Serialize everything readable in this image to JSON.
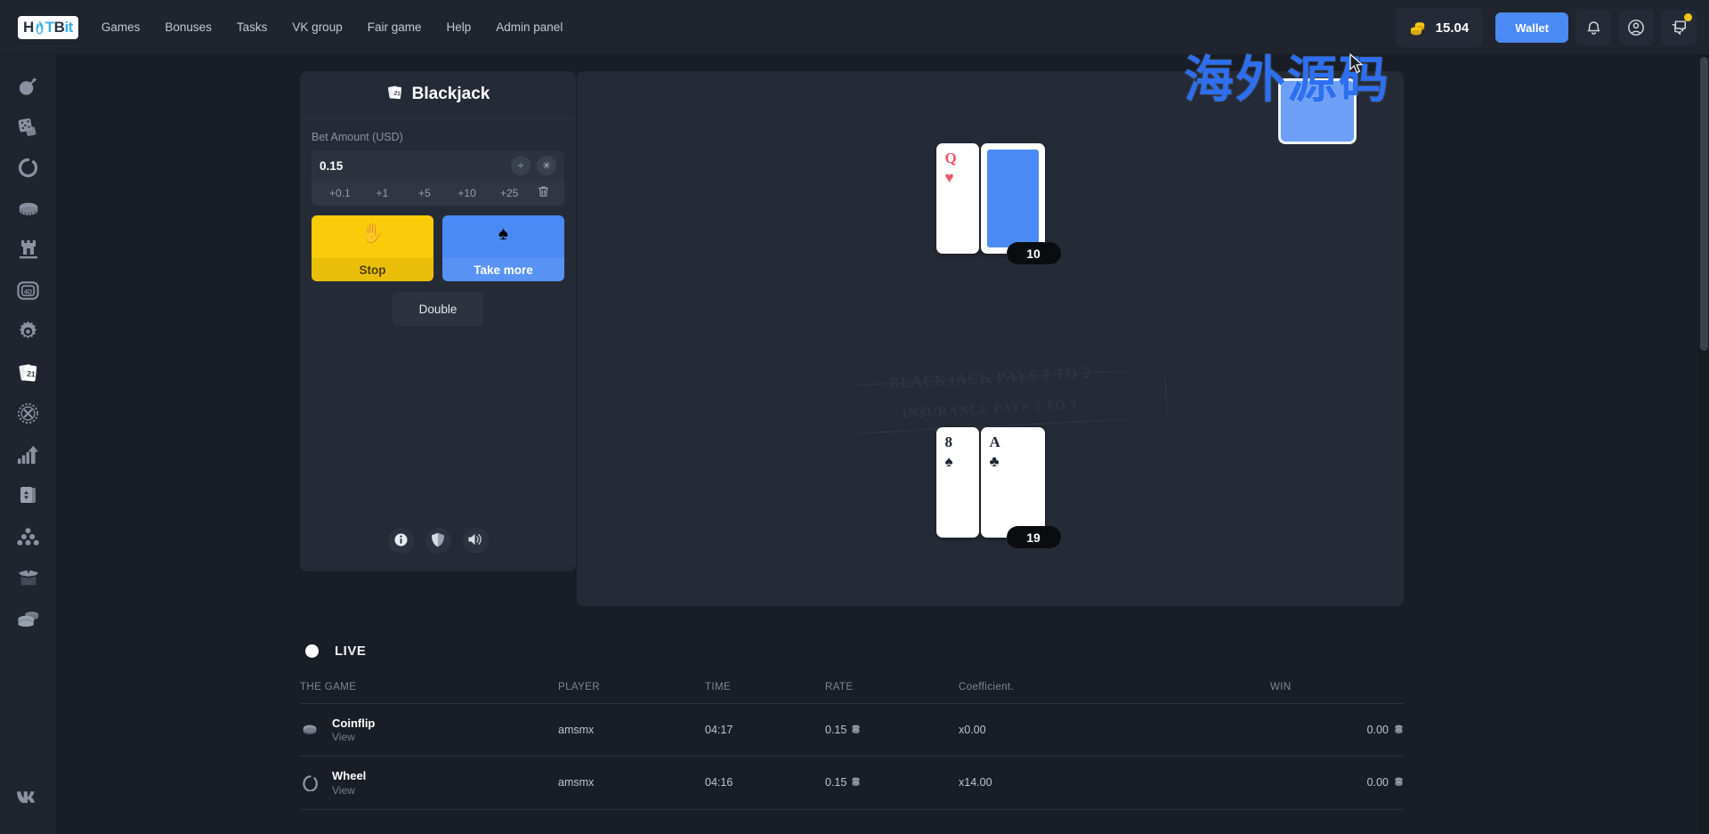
{
  "brand": {
    "logo_h": "H",
    "logo_flame": "flame-icon",
    "logo_t": "T",
    "logo_b": "B",
    "logo_it": "it"
  },
  "nav": {
    "items": [
      {
        "label": "Games"
      },
      {
        "label": "Bonuses"
      },
      {
        "label": "Tasks"
      },
      {
        "label": "VK group"
      },
      {
        "label": "Fair game"
      },
      {
        "label": "Help"
      },
      {
        "label": "Admin panel"
      }
    ]
  },
  "topbar": {
    "balance": "15.04",
    "balance_icon": "coin-stack-icon",
    "wallet_label": "Wallet",
    "bell_icon": "bell-icon",
    "profile_icon": "user-circle-icon",
    "chat_icon": "chat-bubbles-icon",
    "accent": "#4a8af4",
    "coin_color": "#f5c518"
  },
  "sidebar": {
    "items": [
      {
        "name": "mines",
        "icon": "bomb-icon"
      },
      {
        "name": "dice",
        "icon": "dice-icon"
      },
      {
        "name": "wheel",
        "icon": "ring-icon"
      },
      {
        "name": "coinflip",
        "icon": "coin-icon"
      },
      {
        "name": "tower",
        "icon": "tower-icon"
      },
      {
        "name": "slot-4d",
        "icon": "slot-4d-icon",
        "badge": "4D"
      },
      {
        "name": "settings-game",
        "icon": "gear-icon"
      },
      {
        "name": "blackjack",
        "icon": "cards-21-icon",
        "badge": "21",
        "active": true
      },
      {
        "name": "roulette",
        "icon": "roulette-x-icon"
      },
      {
        "name": "crash",
        "icon": "growth-chart-icon"
      },
      {
        "name": "hi-lo",
        "icon": "cards-hilo-icon"
      },
      {
        "name": "plinko",
        "icon": "plinko-pyramid-icon"
      },
      {
        "name": "cases",
        "icon": "open-box-icon"
      },
      {
        "name": "jackpot",
        "icon": "coin-stack-icon"
      }
    ],
    "bottom": {
      "name": "vk",
      "icon": "vk-icon"
    }
  },
  "panel": {
    "title": "Blackjack",
    "title_icon": "cards-21-icon",
    "bet_label": "Bet Amount (USD)",
    "bet_value": "0.15",
    "divide_glyph": "÷",
    "multiply_glyph": "✳",
    "divide_name": "halve-bet-button",
    "multiply_name": "double-bet-button",
    "chips": [
      {
        "label": "+0.1"
      },
      {
        "label": "+1"
      },
      {
        "label": "+5"
      },
      {
        "label": "+10"
      },
      {
        "label": "+25"
      }
    ],
    "trash_icon": "trash-icon",
    "stop_label": "Stop",
    "stop_glyph": "✋",
    "stop_color": "#f9cb0a",
    "take_label": "Take more",
    "take_glyph": "♠",
    "take_color": "#4a8af4",
    "double_label": "Double",
    "footer": [
      {
        "icon": "info-icon"
      },
      {
        "icon": "shield-icon"
      },
      {
        "icon": "sound-on-icon"
      }
    ]
  },
  "board": {
    "felt_line_1": "BLACKJACK PAYS 3 TO 2",
    "felt_line_2": "INSURANCE PAYS 2 TO 1",
    "dealer": {
      "score": "10",
      "cards": [
        {
          "rank": "Q",
          "suit": "♥",
          "color": "red",
          "face_up": true
        },
        {
          "rank": "",
          "suit": "",
          "color": "",
          "face_up": false
        }
      ]
    },
    "player": {
      "score": "19",
      "cards": [
        {
          "rank": "8",
          "suit": "♠",
          "color": "black",
          "face_up": true
        },
        {
          "rank": "A",
          "suit": "♣",
          "color": "black",
          "face_up": true
        }
      ]
    }
  },
  "watermark": {
    "text": "海外源码"
  },
  "live": {
    "label": "LIVE",
    "headers": {
      "game": "THE GAME",
      "player": "PLAYER",
      "time": "TIME",
      "rate": "RATE",
      "coefficient": "Coefficient.",
      "win": "WIN"
    },
    "rows": [
      {
        "game": "Coinflip",
        "game_icon": "coin-icon",
        "view": "View",
        "player": "amsmx",
        "time": "04:17",
        "rate": "0.15",
        "coefficient": "x0.00",
        "win": "0.00"
      },
      {
        "game": "Wheel",
        "game_icon": "ring-icon",
        "view": "View",
        "player": "amsmx",
        "time": "04:16",
        "rate": "0.15",
        "coefficient": "x14.00",
        "win": "0.00"
      }
    ]
  }
}
